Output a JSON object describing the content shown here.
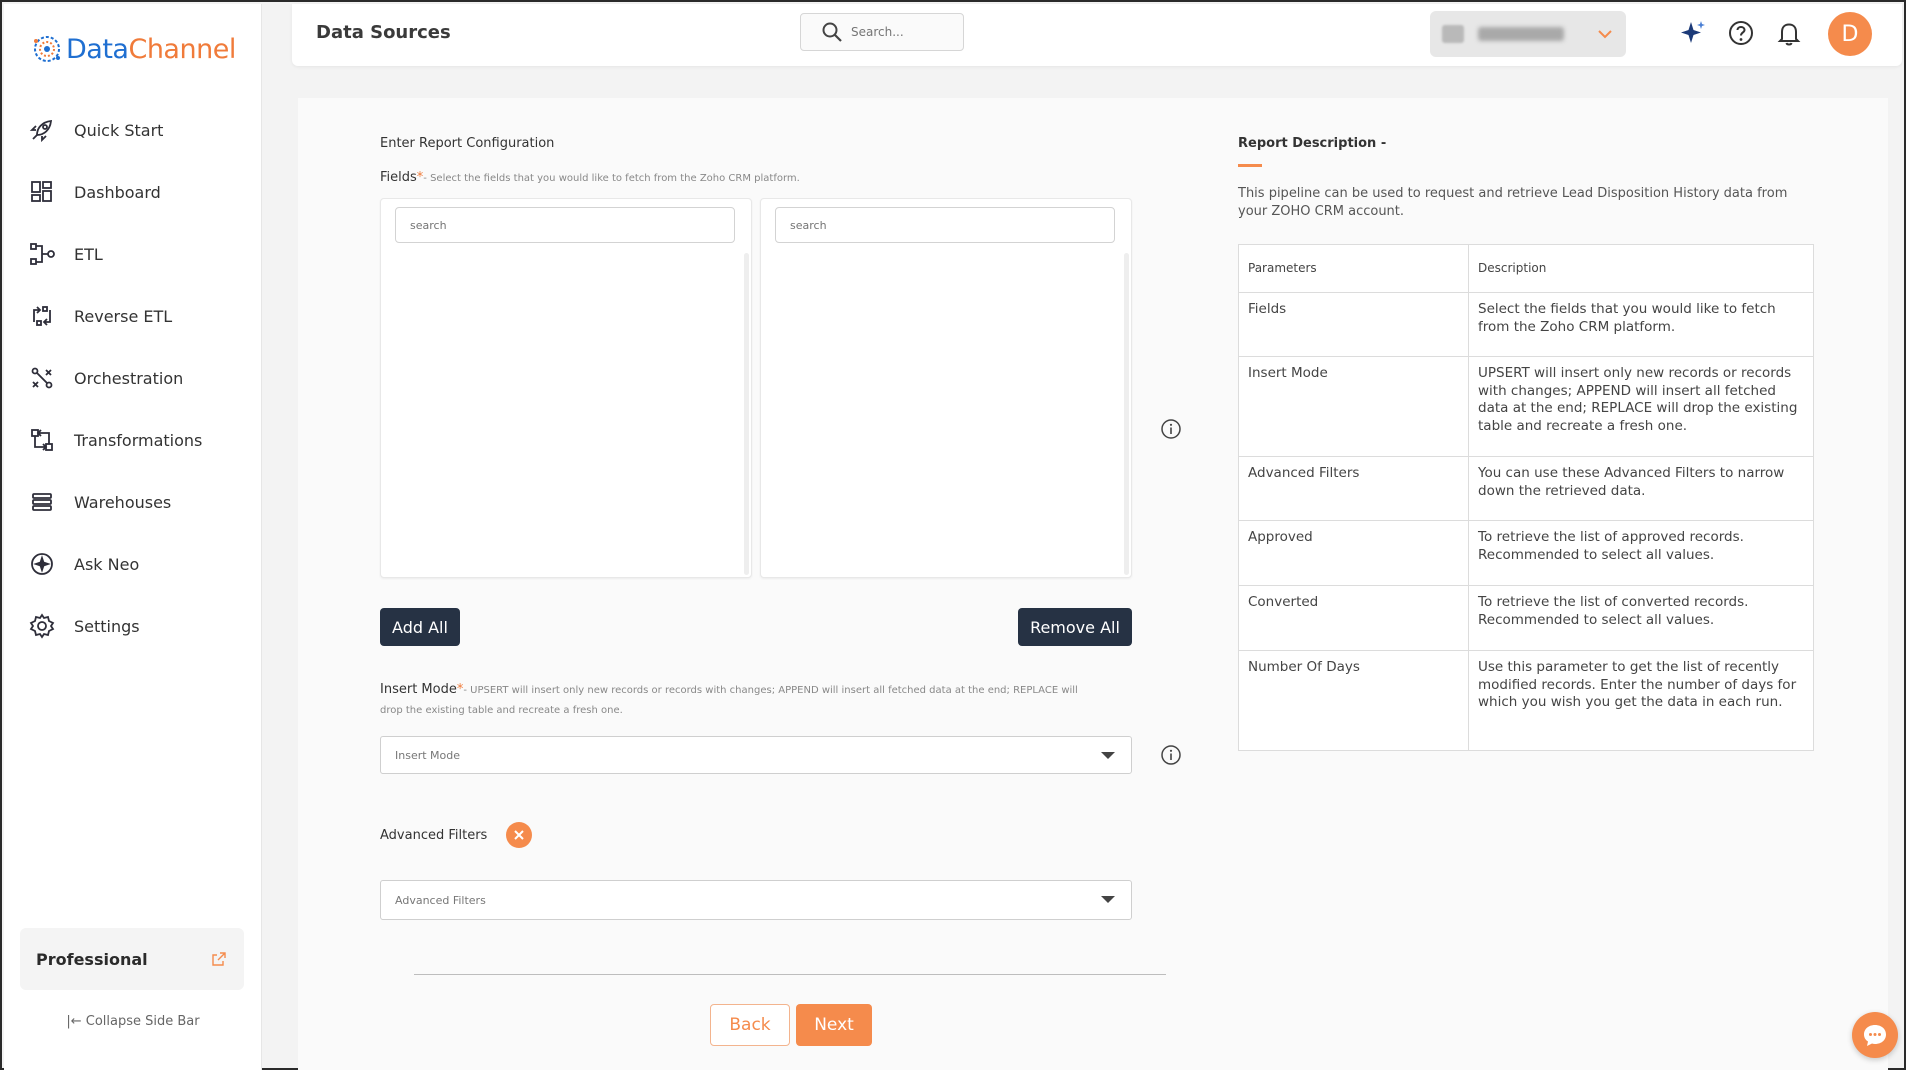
{
  "brand": {
    "name_part1": "Data",
    "name_part2": "Channel"
  },
  "sidebar": {
    "items": [
      {
        "label": "Quick Start",
        "icon": "rocket-icon"
      },
      {
        "label": "Dashboard",
        "icon": "dashboard-icon"
      },
      {
        "label": "ETL",
        "icon": "etl-icon"
      },
      {
        "label": "Reverse ETL",
        "icon": "reverse-etl-icon"
      },
      {
        "label": "Orchestration",
        "icon": "orchestration-icon"
      },
      {
        "label": "Transformations",
        "icon": "transformations-icon"
      },
      {
        "label": "Warehouses",
        "icon": "warehouses-icon"
      },
      {
        "label": "Ask Neo",
        "icon": "ask-neo-icon"
      },
      {
        "label": "Settings",
        "icon": "gear-icon"
      }
    ],
    "plan_label": "Professional",
    "collapse_label": "Collapse Side Bar"
  },
  "header": {
    "title": "Data Sources",
    "search_placeholder": "Search...",
    "avatar_initial": "D"
  },
  "form": {
    "section_title": "Enter Report Configuration",
    "fields_label": "Fields",
    "fields_hint": "- Select the fields that you would like to fetch from the Zoho CRM platform.",
    "left_search_placeholder": "search",
    "right_search_placeholder": "search",
    "add_all_label": "Add All",
    "remove_all_label": "Remove All",
    "insert_mode_label": "Insert Mode",
    "insert_mode_hint": "- UPSERT will insert only new records or records with changes; APPEND will insert all fetched data at the end; REPLACE will drop the existing table and recreate a fresh one.",
    "insert_mode_placeholder": "Insert Mode",
    "advanced_filters_label": "Advanced Filters",
    "advanced_filters_placeholder": "Advanced Filters",
    "back_label": "Back",
    "next_label": "Next"
  },
  "report": {
    "title": "Report Description -",
    "description": "This pipeline can be used to request and retrieve Lead Disposition History data from your ZOHO CRM account.",
    "table_headers": [
      "Parameters",
      "Description"
    ],
    "rows": [
      {
        "param": "Fields",
        "desc": "Select the fields that you would like to fetch from the Zoho CRM platform."
      },
      {
        "param": "Insert Mode",
        "desc": "UPSERT will insert only new records or records with changes; APPEND will insert all fetched data at the end; REPLACE will drop the existing table and recreate a fresh one."
      },
      {
        "param": "Advanced Filters",
        "desc": "You can use these Advanced Filters to narrow down the retrieved data."
      },
      {
        "param": "Approved",
        "desc": "To retrieve the list of approved records. Recommended to select all values."
      },
      {
        "param": "Converted",
        "desc": "To retrieve the list of converted records. Recommended to select all values."
      },
      {
        "param": "Number Of Days",
        "desc": "Use this parameter to get the list of recently modified records. Enter the number of days for which you wish you get the data in each run."
      }
    ]
  },
  "colors": {
    "accent": "#f58b4c",
    "dark_button": "#263244",
    "brand_blue": "#1f6fd1"
  }
}
